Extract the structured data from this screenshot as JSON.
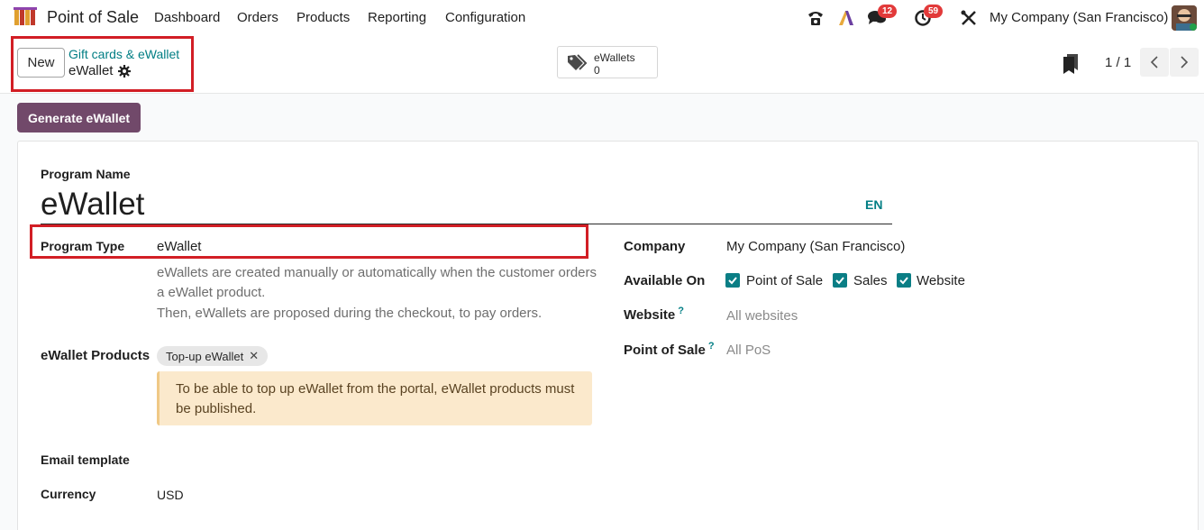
{
  "navbar": {
    "app_name": "Point of Sale",
    "menu": [
      "Dashboard",
      "Orders",
      "Products",
      "Reporting",
      "Configuration"
    ],
    "messages_count": "12",
    "activities_count": "59",
    "company": "My Company (San Francisco)",
    "icons": [
      "phone-icon",
      "ai-icon",
      "chat-icon",
      "activity-clock-icon",
      "tools-icon"
    ]
  },
  "control": {
    "new_label": "New",
    "breadcrumb_parent": "Gift cards & eWallet",
    "breadcrumb_current": "eWallet",
    "smart_label": "eWallets",
    "smart_value": "0",
    "pager": "1 / 1"
  },
  "form": {
    "generate_label": "Generate eWallet",
    "program_name_label": "Program Name",
    "program_name_value": "eWallet",
    "lang": "EN",
    "program_type_label": "Program Type",
    "program_type_value": "eWallet",
    "help_line1": "eWallets are created manually or automatically when the customer orders",
    "help_line2": "a eWallet product.",
    "help_line3": "Then, eWallets are proposed during the checkout, to pay orders.",
    "products_label": "eWallet Products",
    "product_tag": "Top-up eWallet",
    "alert_line1": "To be able to top up eWallet from the portal, eWallet products must",
    "alert_line2": "be published.",
    "email_template_label": "Email template",
    "currency_label": "Currency",
    "currency_value": "USD",
    "company_label": "Company",
    "company_value": "My Company (San Francisco)",
    "available_on_label": "Available On",
    "available_on": [
      "Point of Sale",
      "Sales",
      "Website"
    ],
    "website_label": "Website",
    "website_placeholder": "All websites",
    "pos_label": "Point of Sale",
    "pos_placeholder": "All PoS",
    "help_mark": "?"
  },
  "colors": {
    "brand": "#71496a",
    "link": "#017e84",
    "highlight": "#d21e25",
    "badge": "#e23a3a",
    "checkbox": "#0a7e85"
  }
}
